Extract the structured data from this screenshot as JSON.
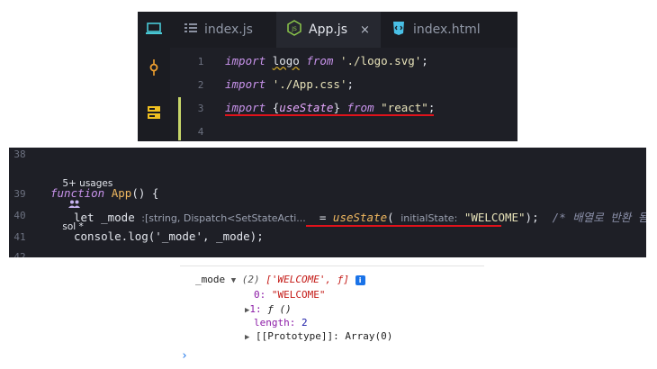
{
  "editor": {
    "tabs": [
      {
        "label": "index.js",
        "icon": "list-icon"
      },
      {
        "label": "App.js",
        "icon": "js-file-icon",
        "close": "×"
      },
      {
        "label": "index.html",
        "icon": "html-file-icon"
      }
    ],
    "line_numbers": [
      "1",
      "2",
      "3",
      "4"
    ],
    "lines": [
      {
        "kw": "import",
        "ident": "logo",
        "from": "from",
        "str": "'./logo.svg'",
        "end": ";"
      },
      {
        "kw": "import",
        "str": "'./App.css'",
        "end": ";"
      },
      {
        "kw": "import",
        "brace_open": "{",
        "ident": "useState",
        "brace_close": "}",
        "from": "from",
        "str": "\"react\"",
        "end": ";"
      }
    ]
  },
  "snippet": {
    "line_numbers": [
      "38",
      "39",
      "40",
      "41",
      "42"
    ],
    "codelens": {
      "usages": "5+ usages",
      "author": "sol *"
    },
    "line39": {
      "kw": "function",
      "name": "App",
      "rest": "() {"
    },
    "line40": {
      "kw": "let",
      "var": "_mode",
      "type_hint": ":[string, Dispatch<SetStateActi...",
      "eq": "=",
      "fn": "useState",
      "paren_open": "(",
      "param_hint": "initialState:",
      "arg": "\"WELCOME\"",
      "paren_close": ");",
      "comment": "/* 배열로 반환 됨 */"
    },
    "line41": {
      "text": "console.log('_mode', _mode);"
    }
  },
  "console": {
    "label": "_mode",
    "summary_count": "(2)",
    "summary_items": "['WELCOME', ƒ]",
    "info_badge": "i",
    "item0_key": "0:",
    "item0_val": "\"WELCOME\"",
    "item1_key": "1:",
    "item1_val": "ƒ ()",
    "length_key": "length:",
    "length_val": "2",
    "proto": "[[Prototype]]: Array(0)",
    "prompt": "›"
  },
  "colors": {
    "underline_red": "#e0121b",
    "modified_marker": "#c7d66a",
    "editor_bg": "#1e1f26"
  }
}
